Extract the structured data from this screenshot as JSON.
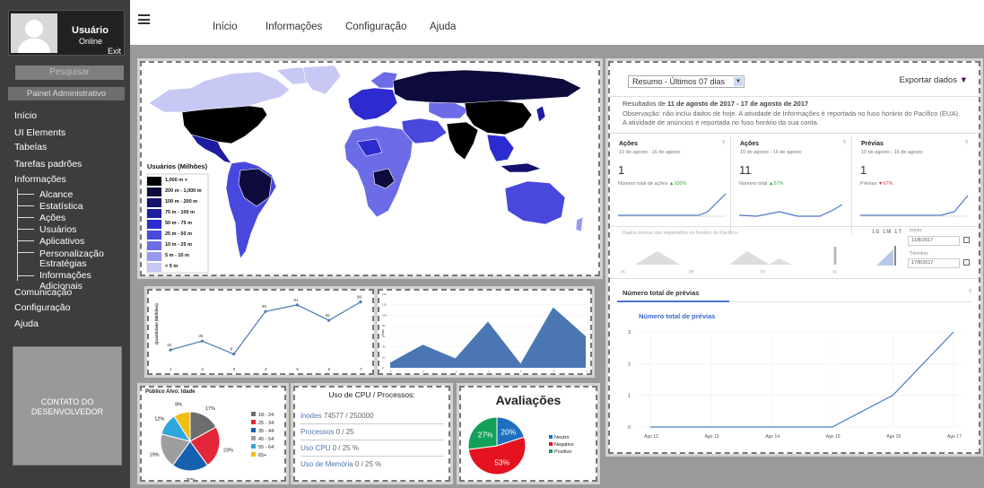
{
  "user": {
    "name": "Usuário",
    "status": "Online",
    "exit": "Exit"
  },
  "sidebar": {
    "search": "Pesquisar",
    "panel": "Painel Administrativo",
    "items": [
      "Início",
      "UI Elements",
      "Tabelas",
      "Tarefas padrões",
      "Informações"
    ],
    "subitems": [
      "Alcance",
      "Estatística",
      "Ações",
      "Usuários",
      "Aplicativos",
      "Personalização",
      "Estratégias",
      "Informações Adicionais"
    ],
    "items2": [
      "Comunicação",
      "Configuração",
      "Ajuda"
    ],
    "contact": [
      "CONTATO DO",
      "DESENVOLVEDOR"
    ]
  },
  "topnav": {
    "items": [
      "Início",
      "Informações",
      "Configuração",
      "Ajuda"
    ]
  },
  "map": {
    "legend_title": "Usuários (Milhões)",
    "legend": [
      {
        "label": "1,000 m +",
        "color": "#000000"
      },
      {
        "label": "200 m - 1,000 m",
        "color": "#0d0a3c"
      },
      {
        "label": "100 m - 200 m",
        "color": "#15126e"
      },
      {
        "label": "75 m - 100 m",
        "color": "#1e1ca0"
      },
      {
        "label": "50 m - 75 m",
        "color": "#2c2bd0"
      },
      {
        "label": "25 m - 50 m",
        "color": "#4848dd"
      },
      {
        "label": "10 m - 25 m",
        "color": "#6c6ce6"
      },
      {
        "label": "5 m - 10 m",
        "color": "#9898ee"
      },
      {
        "label": "< 5 m",
        "color": "#c8c8f5"
      }
    ]
  },
  "line_chart": {
    "ylabel": "Quantidade (Milhões)",
    "x": [
      1,
      2,
      3,
      4,
      5,
      6,
      7
    ],
    "values": [
      15,
      30,
      8,
      80,
      91,
      65,
      96
    ],
    "ymax": 100
  },
  "area_chart": {
    "ylabel": "Vala",
    "x": [
      1,
      2,
      3,
      4,
      5,
      6,
      7
    ],
    "values": [
      10,
      44,
      18,
      88,
      8,
      115,
      60
    ],
    "yticks": [
      0,
      20,
      40,
      60,
      80,
      100,
      120,
      140
    ]
  },
  "chart_data": [
    {
      "type": "line",
      "title": "",
      "ylabel": "Quantidade (Milhões)",
      "x": [
        1,
        2,
        3,
        4,
        5,
        6,
        7
      ],
      "series": [
        {
          "values": [
            15,
            30,
            8,
            80,
            91,
            65,
            96
          ]
        }
      ]
    },
    {
      "type": "area",
      "title": "",
      "ylabel": "Vala",
      "x": [
        1,
        2,
        3,
        4,
        5,
        6,
        7
      ],
      "series": [
        {
          "values": [
            10,
            44,
            18,
            88,
            8,
            115,
            60
          ]
        }
      ],
      "ylim": [
        0,
        140
      ]
    },
    {
      "type": "pie",
      "title": "Público Alvo: Idade",
      "categories": [
        "18 - 24",
        "25 - 34",
        "35 - 44",
        "45 - 54",
        "55 - 64",
        "65+"
      ],
      "values": [
        17,
        23,
        20,
        19,
        12,
        9
      ]
    },
    {
      "type": "pie",
      "title": "Avaliações",
      "categories": [
        "Neutro",
        "Negativo",
        "Positivo"
      ],
      "values": [
        20,
        53,
        27
      ]
    },
    {
      "type": "line",
      "title": "Número total de prévias",
      "x": [
        "Ago 12",
        "Ago 13",
        "Ago 14",
        "Ago 15",
        "Ago 16",
        "Ago 17"
      ],
      "series": [
        {
          "name": "Número total de prévias",
          "values": [
            0,
            0,
            0,
            0,
            1,
            3
          ]
        }
      ],
      "ylim": [
        0,
        3
      ]
    }
  ],
  "age_pie": {
    "title": "Público Alvo: Idade",
    "slices": [
      {
        "label": "18 - 24",
        "value": 17,
        "color": "#6d6d6d"
      },
      {
        "label": "25 - 34",
        "value": 23,
        "color": "#e4263a"
      },
      {
        "label": "35 - 44",
        "value": 20,
        "color": "#1760b0"
      },
      {
        "label": "45 - 54",
        "value": 19,
        "color": "#9e9e9e"
      },
      {
        "label": "55 - 64",
        "value": 12,
        "color": "#2fa6dc"
      },
      {
        "label": "65+",
        "value": 9,
        "color": "#f2be0f"
      }
    ]
  },
  "cpu": {
    "title": "Uso de CPU / Processos:",
    "rows": [
      {
        "k": "inodes",
        "v": "74577 / 250000"
      },
      {
        "k": "Processos",
        "v": "0 / 25"
      },
      {
        "k": "Uso CPU",
        "v": "0 / 25 %"
      },
      {
        "k": "Uso de Memória",
        "v": "0 / 25 %"
      }
    ]
  },
  "ratings": {
    "title": "Avaliações",
    "slices": [
      {
        "label": "Neutro",
        "value": 20,
        "color": "#1e6fc0"
      },
      {
        "label": "Negativo",
        "value": 53,
        "color": "#e4131f"
      },
      {
        "label": "Positivo",
        "value": 27,
        "color": "#13a05a"
      }
    ]
  },
  "summary": {
    "select": "Resumo - Últimos 07 dias",
    "export": "Exportar dados",
    "range_prefix": "Resultados de ",
    "range": "11 de agosto de 2017 - 17 de agosto de 2017",
    "note": "Observação: não inclui dados de hoje. A atividade de Informações é reportada no fuso horário do Pacífico (EUA). A atividade de anúncios é reportada no fuso horário da sua conta.",
    "cards": [
      {
        "title": "Ações",
        "dates": "10 de agosto - 16 de agosto",
        "value": "1",
        "label": "Número total de ações",
        "change": "100%",
        "dir": "up"
      },
      {
        "title": "Ações",
        "dates": "10 de agosto - 16 de agosto",
        "value": "11",
        "label": "Número total",
        "change": "57%",
        "dir": "up"
      },
      {
        "title": "Prévias",
        "dates": "10 de agosto - 16 de agosto",
        "value": "1",
        "label": "Prévias",
        "change": "67%",
        "dir": "down"
      }
    ],
    "daily_note": "Dados diários são registrados no horário do Pacífico.",
    "periods": "1S 1M 1T",
    "start_label": "Início:",
    "start_date": "11/8/2017",
    "end_label": "Término:",
    "end_date": "17/8/2017",
    "timeline_ticks": [
      "21",
      "28",
      "04",
      "11"
    ],
    "tab": "Número total de prévias",
    "chart_title": "Número total de prévias",
    "chart_x": [
      "Ago 12",
      "Ago 13",
      "Ago 14",
      "Ago 15",
      "Ago 16",
      "Ago 17"
    ],
    "chart_y": [
      0,
      0,
      0,
      0,
      1,
      3
    ],
    "yticks": [
      "0",
      "1",
      "2",
      "3"
    ]
  }
}
